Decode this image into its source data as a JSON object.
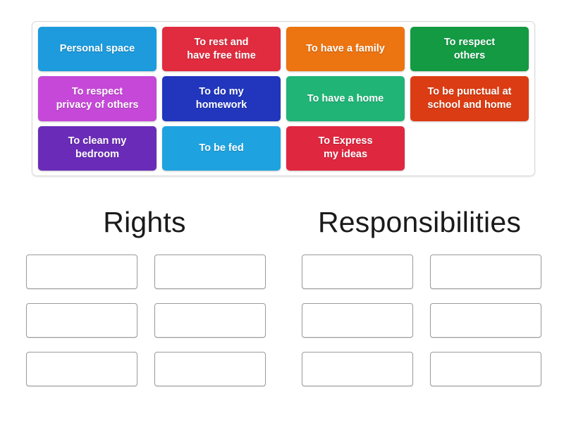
{
  "activity": {
    "type": "sort-into-groups",
    "tray": {
      "name": "word-tile-tray",
      "tiles": [
        {
          "label": "Personal space",
          "color": "#1d9bdd"
        },
        {
          "label": "To rest and\nhave free time",
          "color": "#e12b3e"
        },
        {
          "label": "To have a family",
          "color": "#ec7411"
        },
        {
          "label": "To respect\nothers",
          "color": "#139a43"
        },
        {
          "label": "To respect\nprivacy of others",
          "color": "#c648d8"
        },
        {
          "label": "To do my\nhomework",
          "color": "#2136bd"
        },
        {
          "label": "To have a home",
          "color": "#20b477"
        },
        {
          "label": "To be punctual at\nschool and home",
          "color": "#dc3c13"
        },
        {
          "label": "To clean my\nbedroom",
          "color": "#6a2cb8"
        },
        {
          "label": "To be fed",
          "color": "#1fa3e0"
        },
        {
          "label": "To Express\nmy ideas",
          "color": "#e02740"
        }
      ]
    },
    "groups": [
      {
        "name": "rights",
        "title": "Rights",
        "slot_count": 6
      },
      {
        "name": "responsibilities",
        "title": "Responsibilities",
        "slot_count": 6
      }
    ]
  }
}
